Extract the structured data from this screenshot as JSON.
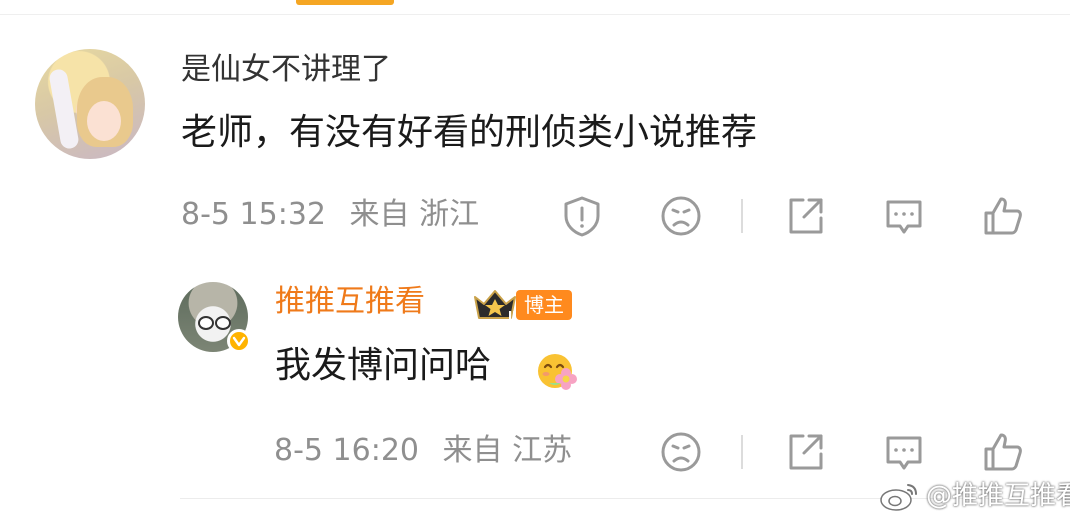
{
  "comment": {
    "username": "是仙女不讲理了",
    "text": "老师，有没有好看的刑侦类小说推荐",
    "timestamp": "8-5 15:32",
    "location": "来自 浙江",
    "actions": [
      "report-icon",
      "dislike-icon",
      "share-icon",
      "reply-icon",
      "like-icon"
    ]
  },
  "reply": {
    "username": "推推互推看",
    "username_color": "#ef7a1a",
    "badge_label": "博主",
    "crown_level": "II",
    "text": "我发博问问哈",
    "emoji": "flower-smile-emoji",
    "timestamp": "8-5 16:20",
    "location": "来自 江苏",
    "actions": [
      "dislike-icon",
      "share-icon",
      "reply-icon",
      "like-icon"
    ]
  },
  "watermark": {
    "text": "@推推互推看"
  },
  "colors": {
    "accent": "#f5a623",
    "meta_text": "#8f8f8f",
    "badge_bg": "#ff8a1e"
  }
}
